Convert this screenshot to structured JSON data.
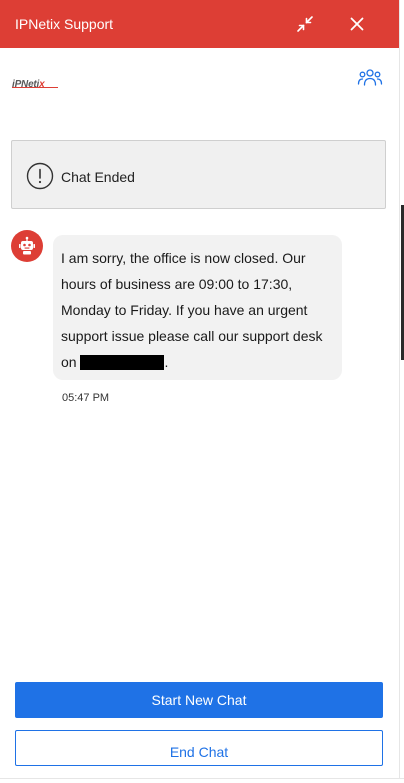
{
  "header": {
    "title": "IPNetix Support",
    "background": "#dd3e35"
  },
  "brand": {
    "logo_text_main": "iPNeti",
    "logo_text_accent": "x"
  },
  "icons": {
    "minimize": "minimize-arrows-icon",
    "close": "close-icon",
    "agents": "users-group-icon",
    "status": "exclamation-circle-icon",
    "avatar": "robot-icon"
  },
  "status": {
    "text": "Chat Ended"
  },
  "message": {
    "text": "I am sorry, the office is now closed. Our hours of business are 09:00 to 17:30, Monday to Friday. If you have an urgent support issue please call our support desk on",
    "suffix": ".",
    "time": "05:47 PM"
  },
  "actions": {
    "start_new_chat": "Start New Chat",
    "end_chat": "End Chat"
  },
  "colors": {
    "accent": "#dd3e35",
    "primary_button": "#1f72e6",
    "bubble": "#f2f2f2"
  }
}
